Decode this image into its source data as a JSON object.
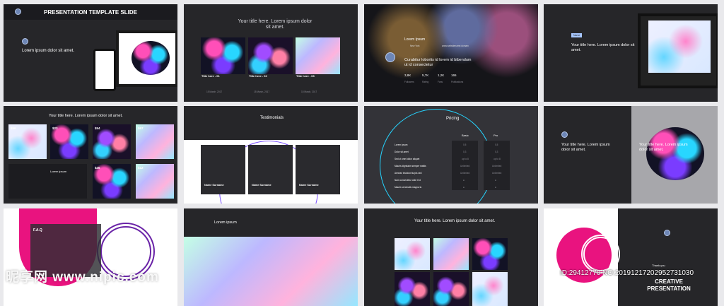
{
  "slides": [
    {
      "title": "PRESENTATION TEMPLATE SLIDE",
      "heading": "Lorem ipsum dolor sit amet."
    },
    {
      "heading": "Your title here. Lorem ipsum dolor sit amet.",
      "items": [
        {
          "title": "Title here - 01",
          "date": "15 March, 2017"
        },
        {
          "title": "Title here - 02",
          "date": "15 March, 2017"
        },
        {
          "title": "Title here - 03",
          "date": "15 March, 2017"
        }
      ]
    },
    {
      "heading": "Lorem Ipsum",
      "location": "New York",
      "website": "www.websitename.domain",
      "tagline": "Curabitur lobortis id lorem id bibendum ut id consectetur",
      "stats": [
        {
          "value": "3,8K",
          "label": "Followers"
        },
        {
          "value": "5,7K",
          "label": "Rating"
        },
        {
          "value": "1,2K",
          "label": "Fans"
        },
        {
          "value": "165",
          "label": "Publications"
        }
      ]
    },
    {
      "badge": "Name",
      "heading": "Your title here. Lorem ipsum dolor sit amet."
    },
    {
      "heading": "Your title here. Lorem ipsum dolor sit amet.",
      "prices": [
        {
          "value": "$56",
          "old": "$66",
          "label": "Category"
        },
        {
          "value": "$23",
          "old": "",
          "label": ""
        },
        {
          "value": "$54",
          "old": "",
          "label": ""
        },
        {
          "value": "$67",
          "old": "",
          "label": ""
        },
        {
          "value": "$45",
          "old": "$95",
          "label": ""
        },
        {
          "value": "$12",
          "old": "$36",
          "label": ""
        }
      ],
      "caption": "Lorem ipsum"
    },
    {
      "heading": "Testimonials",
      "names": [
        "Name Surname",
        "Name Surname",
        "Name Surname"
      ]
    },
    {
      "heading": "Pricing",
      "plans": [
        "Basic",
        "Pro"
      ],
      "rows": [
        "Lorem ipsum",
        "Dolor sit amet",
        "Sed ut omni dolor aliquet",
        "Mauris dignissim semper mattis",
        "Aenean tincidunt turpis sed",
        "Nam consectetur ante il id",
        "Mauris venenatis magna tu"
      ],
      "basic": [
        "0,5",
        "0,3",
        "up to 8",
        "Unlimited",
        "Unlimited",
        "●",
        "●"
      ],
      "pro": [
        "0,5",
        "0,3",
        "up to 8",
        "Unlimited",
        "Unlimited",
        "●",
        "●"
      ]
    },
    {
      "heading": "Your title here. Lorem ipsum dolor sit amet."
    },
    {
      "heading": "F.A.Q"
    },
    {
      "heading": "Lorem ipsum"
    },
    {
      "heading": "Your title here. Lorem ipsum dolor sit amet."
    },
    {
      "heading": "CREATIVE PRESENTATION",
      "thanks": "Thank you"
    }
  ],
  "watermark": "昵享网 www.nipic.com",
  "credit": "ID:29412770 NO:20191217202952731030"
}
